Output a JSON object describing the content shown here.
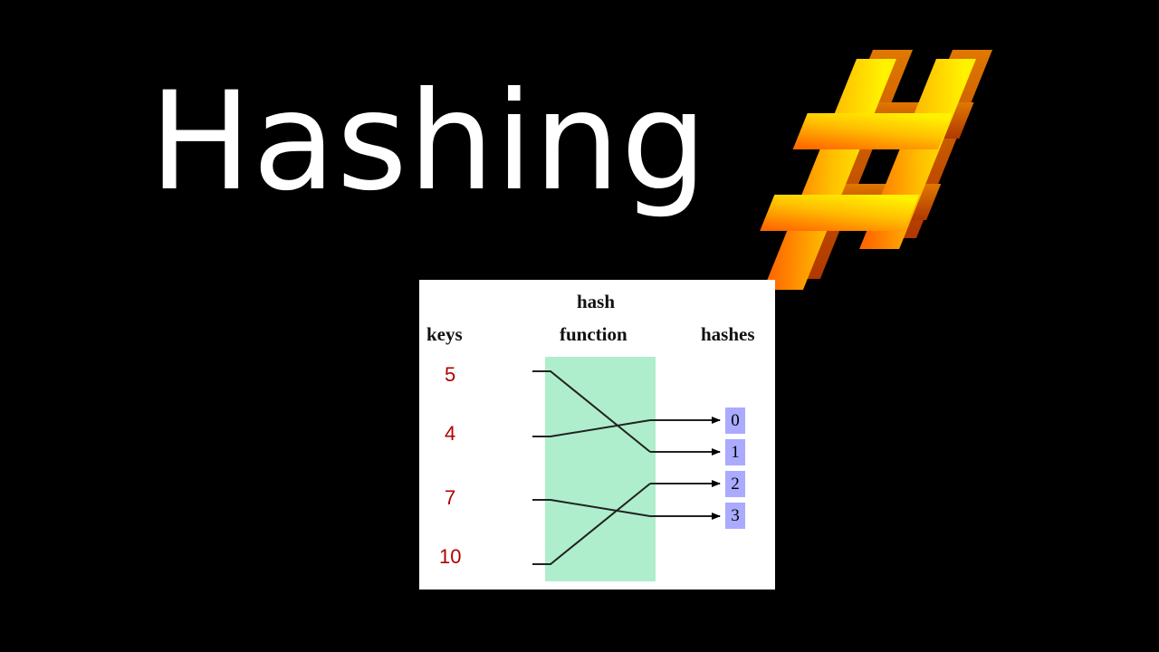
{
  "title": "Hashing",
  "logo": {
    "icon": "hash-icon",
    "colors": [
      "#ffe600",
      "#ff8a00",
      "#ff5a00"
    ]
  },
  "diagram": {
    "headers": {
      "keys": "keys",
      "hash_line1": "hash",
      "hash_line2": "function",
      "hashes": "hashes"
    },
    "keys": [
      "5",
      "4",
      "7",
      "10"
    ],
    "buckets": [
      "0",
      "1",
      "2",
      "3"
    ],
    "mapping": [
      {
        "key": "5",
        "hash": "1"
      },
      {
        "key": "4",
        "hash": "0"
      },
      {
        "key": "7",
        "hash": "3"
      },
      {
        "key": "10",
        "hash": "2"
      }
    ],
    "colors": {
      "function_box": "#aeeecc",
      "bucket": "#aaaaff",
      "key_text": "#b00000"
    }
  }
}
